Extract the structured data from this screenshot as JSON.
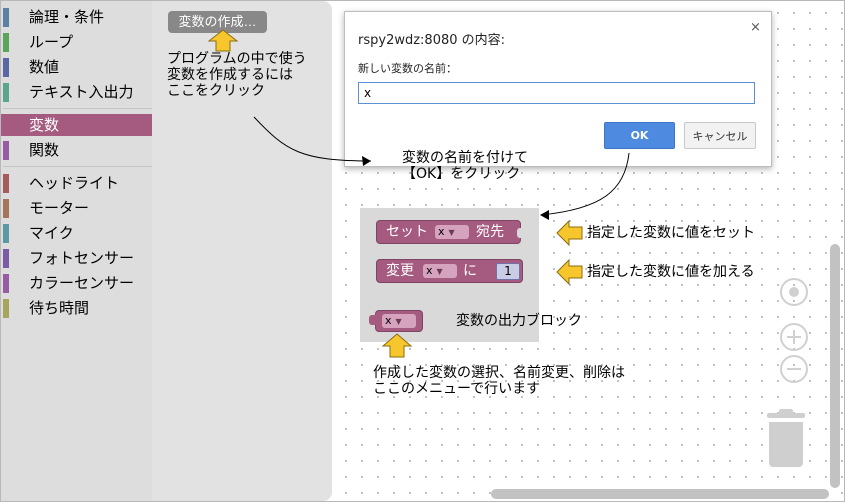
{
  "toolbox": {
    "categories": [
      {
        "label": "論理・条件",
        "color": "#5b80a5"
      },
      {
        "label": "ループ",
        "color": "#5ba55b"
      },
      {
        "label": "数値",
        "color": "#5b67a5"
      },
      {
        "label": "テキスト入出力",
        "color": "#5ba58c"
      },
      {
        "label": "変数",
        "color": "#a55b80"
      },
      {
        "label": "関数",
        "color": "#995ba5"
      },
      {
        "label": "ヘッドライト",
        "color": "#a55b5b"
      },
      {
        "label": "モーター",
        "color": "#a5745b"
      },
      {
        "label": "マイク",
        "color": "#5b9aa5"
      },
      {
        "label": "フォトセンサー",
        "color": "#7b5ba5"
      },
      {
        "label": "カラーセンサー",
        "color": "#9a5ba5"
      },
      {
        "label": "待ち時間",
        "color": "#a5a55b"
      }
    ]
  },
  "flyout": {
    "create_variable_label": "変数の作成…"
  },
  "dialog": {
    "title": "rspy2wdz:8080 の内容:",
    "close": "×",
    "message": "新しい変数の名前：",
    "input_value": "x",
    "ok_label": "OK",
    "cancel_label": "キャンセル"
  },
  "blocks": {
    "set": {
      "prefix": "セット",
      "var": "x",
      "suffix": "宛先"
    },
    "change": {
      "prefix": "変更",
      "var": "x",
      "mid": "に",
      "value": "1"
    },
    "getter": {
      "var": "x"
    }
  },
  "annotations": {
    "create_note": [
      "プログラムの中で使う",
      "変数を作成するには",
      "ここをクリック"
    ],
    "ok_note": [
      "変数の名前を付けて",
      "【OK】をクリック"
    ],
    "set_note": "指定した変数に値をセット",
    "change_note": "指定した変数に値を加える",
    "getter_note": "変数の出力ブロック",
    "menu_note": [
      "作成した変数の選択、名前変更、削除は",
      "ここのメニューで行います"
    ]
  },
  "colors": {
    "variable_block": "#a55b80",
    "arrow_fill": "#f7c52c",
    "ok_button": "#4d8ae0"
  }
}
